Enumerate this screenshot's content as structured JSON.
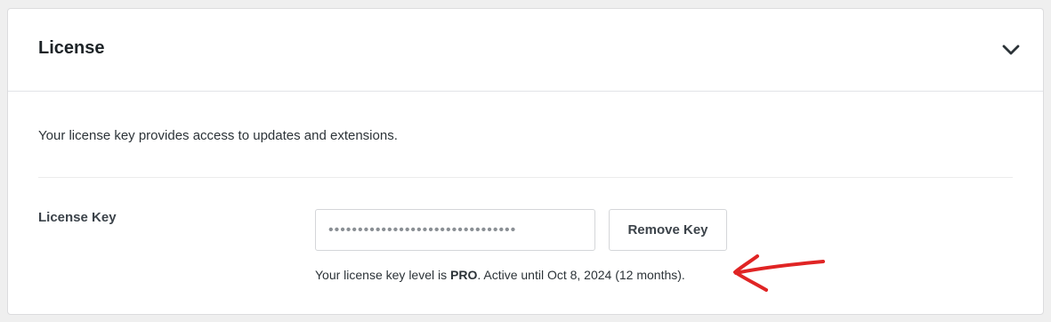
{
  "panel": {
    "title": "License",
    "toggle_icon": "chevron-down-icon"
  },
  "description": "Your license key provides access to updates and extensions.",
  "license_key": {
    "label": "License Key",
    "value": "••••••••••••••••••••••••••••••••",
    "remove_label": "Remove Key"
  },
  "status": {
    "prefix": "Your license key level is ",
    "level": "PRO",
    "suffix": ". Active until Oct 8, 2024 (12 months)."
  },
  "annotation": {
    "icon": "hand-drawn-arrow-icon",
    "color": "#e02424"
  }
}
